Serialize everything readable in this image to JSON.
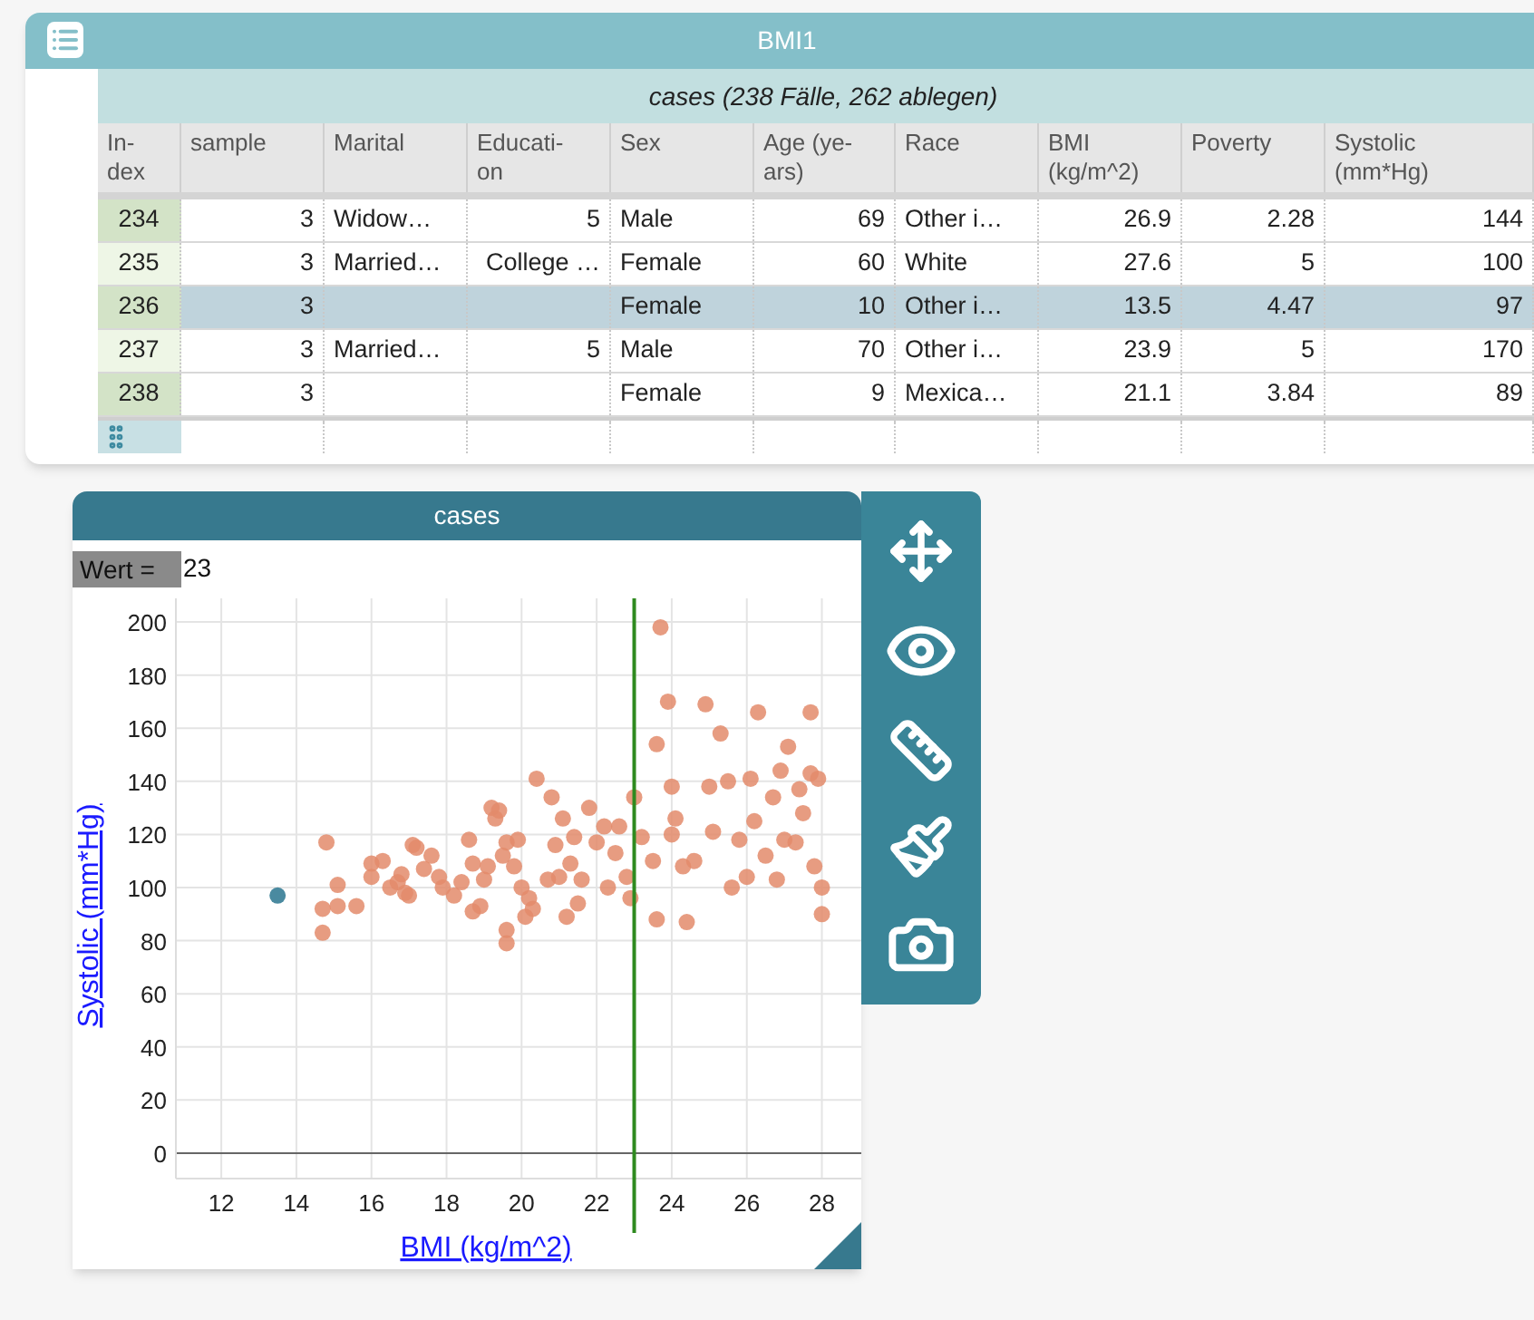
{
  "table_window": {
    "title": "BMI1",
    "subtitle": "cases (238 Fälle, 262 ablegen)",
    "columns": [
      {
        "lines": [
          "In-",
          "dex"
        ],
        "kind": "index"
      },
      {
        "lines": [
          "sample"
        ],
        "kind": "number"
      },
      {
        "lines": [
          "Marital"
        ],
        "kind": "text"
      },
      {
        "lines": [
          "Educati-",
          "on"
        ],
        "kind": "number"
      },
      {
        "lines": [
          "Sex"
        ],
        "kind": "text"
      },
      {
        "lines": [
          "Age (ye-",
          "ars)"
        ],
        "kind": "number"
      },
      {
        "lines": [
          "Race"
        ],
        "kind": "text"
      },
      {
        "lines": [
          "BMI",
          "(kg/m^2)"
        ],
        "kind": "number"
      },
      {
        "lines": [
          "Poverty"
        ],
        "kind": "number"
      },
      {
        "lines": [
          "Systolic",
          "(mm*Hg)"
        ],
        "kind": "number"
      }
    ],
    "rows": [
      {
        "selected": false,
        "cells": [
          "234",
          "3",
          "Widow…",
          "5",
          "Male",
          "69",
          "Other i…",
          "26.9",
          "2.28",
          "144"
        ]
      },
      {
        "selected": false,
        "cells": [
          "235",
          "3",
          "Married…",
          "College …",
          "Female",
          "60",
          "White",
          "27.6",
          "5",
          "100"
        ]
      },
      {
        "selected": true,
        "cells": [
          "236",
          "3",
          "",
          "",
          "Female",
          "10",
          "Other i…",
          "13.5",
          "4.47",
          "97"
        ]
      },
      {
        "selected": false,
        "cells": [
          "237",
          "3",
          "Married…",
          "5",
          "Male",
          "70",
          "Other i…",
          "23.9",
          "5",
          "170"
        ]
      },
      {
        "selected": false,
        "cells": [
          "238",
          "3",
          "",
          "",
          "Female",
          "9",
          "Mexica…",
          "21.1",
          "3.84",
          "89"
        ]
      }
    ]
  },
  "graph_window": {
    "title": "cases",
    "movable_value": {
      "label": "Wert =",
      "value": "23"
    },
    "chart_data": {
      "type": "scatter",
      "xlabel": "BMI (kg/m^2)",
      "ylabel": "Systolic (mm*Hg)",
      "xlim": [
        10.79,
        29.05
      ],
      "ylim": [
        -9.6,
        208.9
      ],
      "grid": true,
      "ref_lines": [
        {
          "axis": "x",
          "value": 23,
          "color": "#2f8a1f"
        }
      ],
      "xticks": [
        12,
        14,
        16,
        18,
        20,
        22,
        24,
        26,
        28
      ],
      "yticks": [
        0,
        20,
        40,
        60,
        80,
        100,
        120,
        140,
        160,
        180,
        200
      ],
      "x": [
        14.7,
        14.7,
        14.8,
        15.1,
        15.1,
        15.6,
        16,
        16,
        16.3,
        16.5,
        16.7,
        16.8,
        16.9,
        17,
        17.1,
        17.2,
        17.4,
        17.6,
        17.8,
        17.9,
        18.2,
        18.4,
        18.6,
        18.7,
        18.7,
        18.9,
        19,
        19.1,
        19.2,
        19.3,
        19.4,
        19.5,
        19.6,
        19.6,
        19.6,
        19.8,
        19.9,
        20,
        20.1,
        20.2,
        20.3,
        20.4,
        20.7,
        20.8,
        20.9,
        21,
        21.1,
        21.2,
        21.3,
        21.4,
        21.5,
        21.6,
        21.8,
        22,
        22.2,
        22.3,
        22.5,
        22.6,
        22.8,
        22.9,
        23,
        23.2,
        23.5,
        23.6,
        23.6,
        23.7,
        23.9,
        24,
        24,
        24.1,
        24.3,
        24.4,
        24.6,
        24.9,
        25,
        25.1,
        25.3,
        25.5,
        25.6,
        25.8,
        26,
        26.1,
        26.2,
        26.3,
        26.5,
        26.7,
        26.8,
        26.9,
        27,
        27.1,
        27.3,
        27.4,
        27.5,
        27.7,
        27.7,
        27.8,
        27.9,
        28,
        28,
        13.5
      ],
      "series": [
        {
          "color": "#e38b6b",
          "values": [
            92,
            83,
            117,
            101,
            93,
            93,
            104,
            109,
            110,
            100,
            102,
            105,
            98,
            97,
            116,
            115,
            107,
            112,
            104,
            100,
            97,
            102,
            118,
            109,
            91,
            93,
            103,
            108,
            130,
            126,
            129,
            112,
            117,
            84,
            79,
            108,
            118,
            100,
            89,
            96,
            92,
            141,
            103,
            134,
            116,
            104,
            126,
            89,
            109,
            119,
            94,
            103,
            130,
            117,
            123,
            100,
            113,
            123,
            104,
            96,
            134,
            119,
            110,
            88,
            154,
            198,
            170,
            120,
            138,
            126,
            108,
            87,
            110,
            169,
            138,
            121,
            158,
            140,
            100,
            118,
            104,
            141,
            125,
            166,
            112,
            134,
            103,
            144,
            118,
            153,
            117,
            137,
            128,
            166,
            143,
            108,
            141,
            90,
            100,
            null
          ]
        },
        {
          "color": "#4a8aa0",
          "values": [
            null,
            null,
            null,
            null,
            null,
            null,
            null,
            null,
            null,
            null,
            null,
            null,
            null,
            null,
            null,
            null,
            null,
            null,
            null,
            null,
            null,
            null,
            null,
            null,
            null,
            null,
            null,
            null,
            null,
            null,
            null,
            null,
            null,
            null,
            null,
            null,
            null,
            null,
            null,
            null,
            null,
            null,
            null,
            null,
            null,
            null,
            null,
            null,
            null,
            null,
            null,
            null,
            null,
            null,
            null,
            null,
            null,
            null,
            null,
            null,
            null,
            null,
            null,
            null,
            null,
            null,
            null,
            null,
            null,
            null,
            null,
            null,
            null,
            null,
            null,
            null,
            null,
            null,
            null,
            null,
            null,
            null,
            null,
            null,
            null,
            null,
            null,
            null,
            null,
            null,
            null,
            null,
            null,
            null,
            null,
            null,
            null,
            null,
            null,
            97
          ]
        }
      ]
    }
  }
}
